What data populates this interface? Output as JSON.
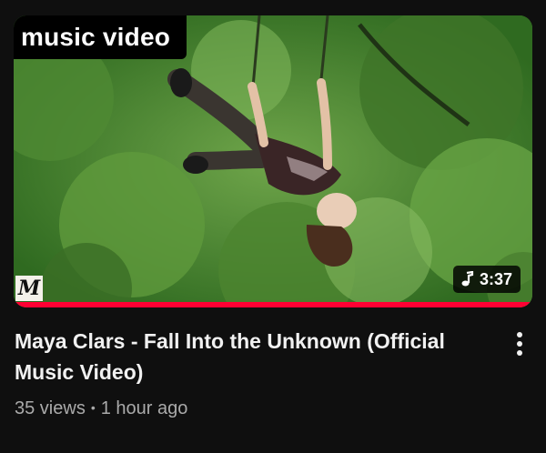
{
  "video": {
    "tag": "music video",
    "channel_logo": "M",
    "duration": "3:37",
    "duration_icon": "music-note-icon",
    "watched_progress": 1.0,
    "progress_color": "#ff0033",
    "title": "Maya Clars - Fall Into the Unknown (Official Music Video)",
    "views": "35 views",
    "separator": "•",
    "age": "1 hour ago",
    "more_icon": "more-vertical-icon"
  }
}
